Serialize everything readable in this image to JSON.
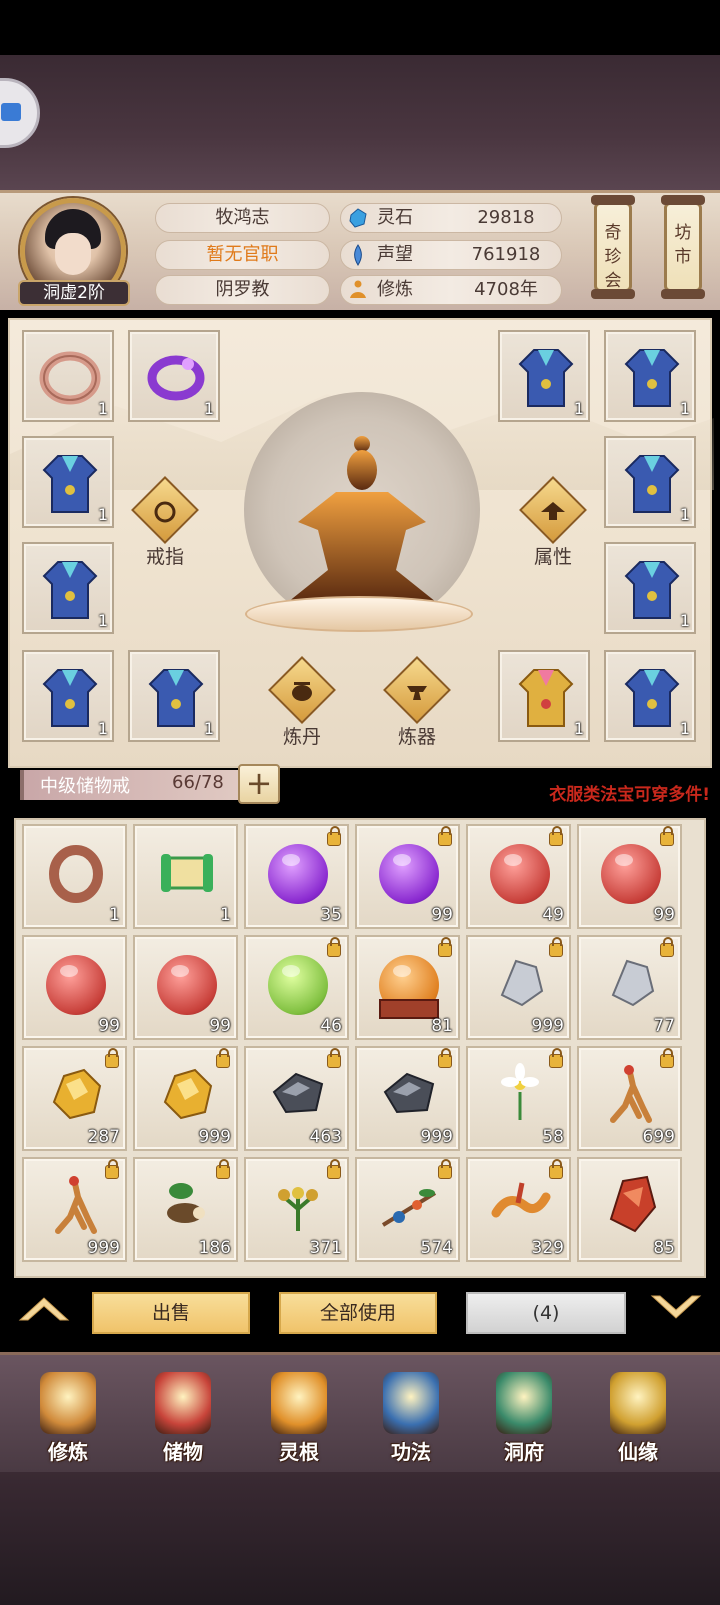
{
  "player": {
    "name": "牧鸿志",
    "rank": "洞虚2阶",
    "official_post": "暂无官职",
    "sect": "阴罗教"
  },
  "stats": {
    "spirit_stone": {
      "label": "灵石",
      "value": "29818"
    },
    "reputation": {
      "label": "声望",
      "value": "761918"
    },
    "cultivation": {
      "label": "修炼",
      "value": "4708年"
    }
  },
  "header_buttons": {
    "treasure_hall": "奇珍会",
    "market": "坊市"
  },
  "equipment": {
    "slots": [
      {
        "count": "1",
        "icon": "ring-icon"
      },
      {
        "count": "1",
        "icon": "purple-bracelet-icon"
      },
      {
        "count": "1",
        "icon": "robe-icon"
      },
      {
        "count": "1",
        "icon": "robe-icon"
      },
      {
        "count": "1",
        "icon": "robe-icon"
      },
      {
        "count": "1",
        "icon": "robe-icon"
      },
      {
        "count": "1",
        "icon": "robe-icon"
      },
      {
        "count": "1",
        "icon": "robe-icon"
      },
      {
        "count": "1",
        "icon": "robe-icon"
      },
      {
        "count": "1",
        "icon": "robe-icon"
      },
      {
        "count": "1",
        "icon": "golden-robe-icon"
      },
      {
        "count": "1",
        "icon": "robe-icon"
      }
    ],
    "actions": {
      "ring": "戒指",
      "attributes": "属性",
      "alchemy": "炼丹",
      "forging": "炼器"
    }
  },
  "storage": {
    "ring_name": "中级储物戒",
    "capacity": "66/78",
    "add_label": "+",
    "tip": "衣服类法宝可穿多件!"
  },
  "items": [
    {
      "icon": "ring-icon",
      "count": "1",
      "locked": false
    },
    {
      "icon": "scroll-icon",
      "count": "1",
      "locked": false
    },
    {
      "icon": "purple-orb-icon",
      "count": "35",
      "locked": true
    },
    {
      "icon": "purple-orb-icon",
      "count": "99",
      "locked": true
    },
    {
      "icon": "red-orb-icon",
      "count": "49",
      "locked": true
    },
    {
      "icon": "red-orb-icon",
      "count": "99",
      "locked": true
    },
    {
      "icon": "red-orb-icon",
      "count": "99",
      "locked": false
    },
    {
      "icon": "red-orb-icon",
      "count": "99",
      "locked": false
    },
    {
      "icon": "green-orb-icon",
      "count": "46",
      "locked": true
    },
    {
      "icon": "orange-orb-pedestal-icon",
      "count": "81",
      "locked": true
    },
    {
      "icon": "silver-ore-icon",
      "count": "999",
      "locked": true
    },
    {
      "icon": "silver-ore-icon",
      "count": "77",
      "locked": true
    },
    {
      "icon": "gold-ore-icon",
      "count": "287",
      "locked": true
    },
    {
      "icon": "gold-ore-icon",
      "count": "999",
      "locked": true
    },
    {
      "icon": "iron-ore-icon",
      "count": "463",
      "locked": true
    },
    {
      "icon": "iron-ore-icon",
      "count": "999",
      "locked": true
    },
    {
      "icon": "white-flower-icon",
      "count": "58",
      "locked": true
    },
    {
      "icon": "ginseng-icon",
      "count": "699",
      "locked": true
    },
    {
      "icon": "ginseng-icon",
      "count": "999",
      "locked": true
    },
    {
      "icon": "herb-root-icon",
      "count": "186",
      "locked": true
    },
    {
      "icon": "herb-flower-icon",
      "count": "371",
      "locked": true
    },
    {
      "icon": "berry-branch-icon",
      "count": "574",
      "locked": true
    },
    {
      "icon": "cordyceps-icon",
      "count": "329",
      "locked": true
    },
    {
      "icon": "red-crystal-icon",
      "count": "85",
      "locked": false
    }
  ],
  "actions": {
    "sell": "出售",
    "use_all": "全部使用",
    "selected": "(4)"
  },
  "nav": [
    {
      "label": "修炼",
      "icon": "cultivate-icon",
      "color": "#d08a3a"
    },
    {
      "label": "储物",
      "icon": "bag-icon",
      "color": "#c8443a"
    },
    {
      "label": "灵根",
      "icon": "spirit-root-icon",
      "color": "#e0902a"
    },
    {
      "label": "功法",
      "icon": "book-icon",
      "color": "#3a6fb0"
    },
    {
      "label": "洞府",
      "icon": "cave-mansion-icon",
      "color": "#3a8a6a"
    },
    {
      "label": "仙缘",
      "icon": "gourd-icon",
      "color": "#d0a030"
    }
  ],
  "colors": {
    "tip_red": "#c9281c",
    "gold_button": "#f0c36a",
    "orange_text": "#e07a1a"
  }
}
